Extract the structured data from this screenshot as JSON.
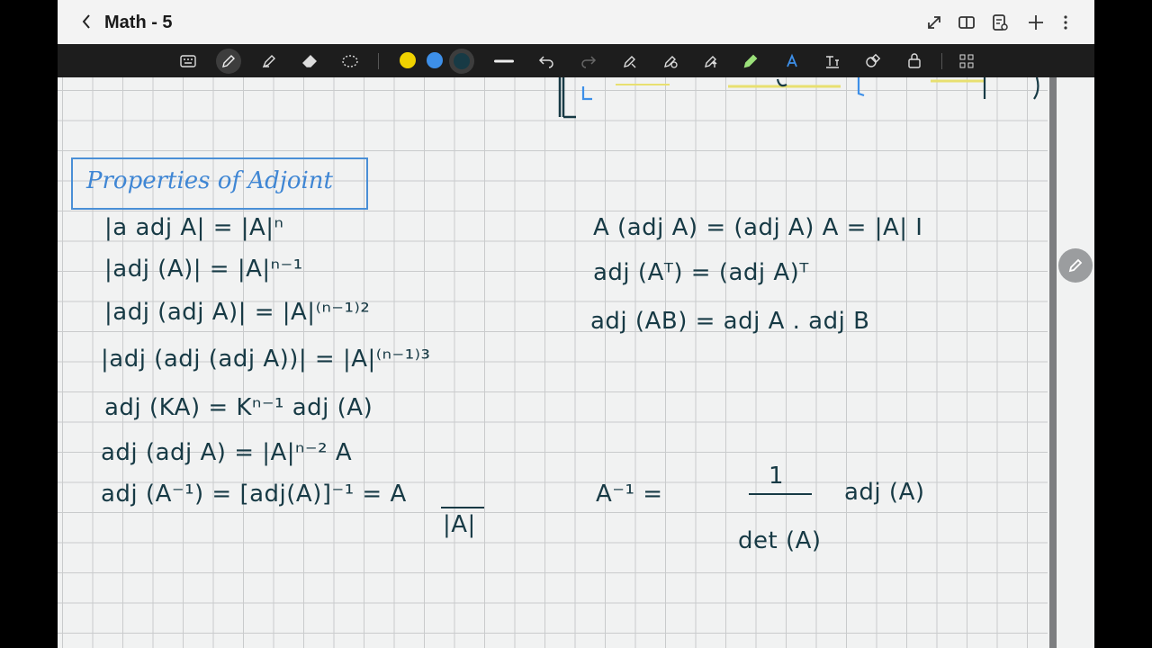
{
  "title": "Math - 5",
  "colors": {
    "swatch_yellow": "#f0d200",
    "swatch_blue": "#3d8fe8",
    "swatch_teal": "#173a45",
    "ink": "#173a45",
    "heading_blue": "#3f86d4"
  },
  "icons": {
    "titlebar": [
      "chevron-left-icon",
      "expand-icon",
      "book-view-icon",
      "page-settings-icon",
      "plus-icon",
      "more-vert-icon"
    ],
    "toolbar": [
      "keyboard-icon",
      "pen-icon",
      "highlighter-icon",
      "eraser-icon",
      "lasso-icon",
      "line-icon",
      "undo-icon",
      "redo-icon",
      "pen-settings-icon",
      "shape-icon",
      "pen-up-icon",
      "pen-color-icon",
      "text-icon",
      "text-box-icon",
      "shapes-icon",
      "lock-icon",
      "apps-icon"
    ]
  },
  "notes": {
    "heading": "Properties of Adjoint",
    "left": [
      "|a adj A| = |A|ⁿ",
      "|adj (A)| = |A|ⁿ⁻¹",
      "|adj (adj A)| = |A|⁽ⁿ⁻¹⁾²",
      "|adj (adj (adj A))| = |A|⁽ⁿ⁻¹⁾³",
      "adj (KA) = Kⁿ⁻¹ adj (A)",
      "adj (adj A) = |A|ⁿ⁻² A",
      "adj (A⁻¹) = [adj(A)]⁻¹ = A"
    ],
    "left_fraction_den": "|A|",
    "right": [
      "A (adj A) = (adj A) A = |A| I",
      "adj (Aᵀ) = (adj A)ᵀ",
      "adj (AB) = adj A . adj B"
    ],
    "inverse_lhs": "A⁻¹ =",
    "inverse_num": "1",
    "inverse_den": "det (A)",
    "inverse_rhs": "adj (A)"
  }
}
